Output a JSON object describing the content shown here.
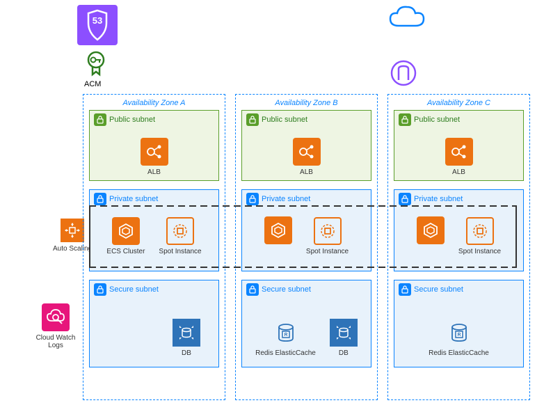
{
  "labels": {
    "acm": "ACM",
    "autoscaling": "Auto Scaling",
    "cloudwatch": "Cloud Watch Logs",
    "zone_a": "Availability Zone A",
    "zone_b": "Availability Zone B",
    "zone_c": "Availability Zone C",
    "public_subnet": "Public subnet",
    "private_subnet": "Private subnet",
    "secure_subnet": "Secure subnet",
    "alb": "ALB",
    "ecs": "ECS Cluster",
    "spot": "Spot Instance",
    "db": "DB",
    "redis": "Redis ElasticCache"
  },
  "architecture": {
    "zones": [
      {
        "id": "A",
        "public": [
          "ALB"
        ],
        "private": [
          "ECS Cluster",
          "Spot Instance"
        ],
        "secure": [
          "DB"
        ]
      },
      {
        "id": "B",
        "public": [
          "ALB"
        ],
        "private": [
          "Spot Instance"
        ],
        "secure": [
          "Redis ElasticCache",
          "DB"
        ]
      },
      {
        "id": "C",
        "public": [
          "ALB"
        ],
        "private": [
          "Spot Instance"
        ],
        "secure": [
          "Redis ElasticCache"
        ]
      }
    ],
    "global": [
      "Route 53",
      "ACM",
      "Internet/Cloud",
      "Gateway"
    ],
    "side": [
      "Auto Scaling",
      "Cloud Watch Logs"
    ]
  }
}
